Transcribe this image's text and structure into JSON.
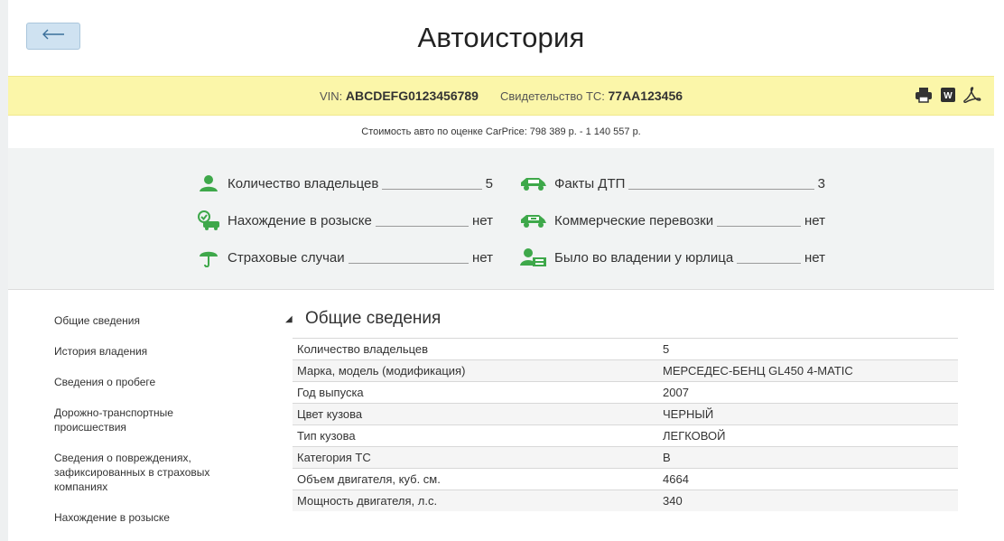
{
  "header": {
    "title": "Автоистория",
    "back_icon": "arrow-left-icon"
  },
  "vin_band": {
    "vin_label": "VIN: ",
    "vin_value": "ABCDEFG0123456789",
    "cert_label": "Свидетельство ТС: ",
    "cert_value": "77AA123456",
    "icons": [
      "printer-icon",
      "word-icon",
      "pdf-icon"
    ],
    "accent": "#fbf6a9"
  },
  "price": {
    "text": "Стоимость авто по оценке CarPrice: 798 389 р. - 1 140 557 р."
  },
  "summary": {
    "items": [
      {
        "icon": "owner-person-icon",
        "label": "Количество владельцев",
        "value": "5"
      },
      {
        "icon": "car-crash-icon",
        "label": "Факты ДТП",
        "value": "3"
      },
      {
        "icon": "car-search-icon",
        "label": "Нахождение в розыске",
        "value": "нет"
      },
      {
        "icon": "taxi-car-icon",
        "label": "Коммерческие перевозки",
        "value": "нет"
      },
      {
        "icon": "umbrella-icon",
        "label": "Страховые случаи",
        "value": "нет"
      },
      {
        "icon": "company-owner-icon",
        "label": "Было во владении у юрлица",
        "value": "нет"
      }
    ],
    "icon_color": "#3ea84a"
  },
  "sidebar": {
    "items": [
      {
        "label": "Общие сведения"
      },
      {
        "label": "История владения"
      },
      {
        "label": "Сведения о пробеге"
      },
      {
        "label": "Дорожно-транспортные происшествия"
      },
      {
        "label": "Сведения о повреждениях, зафиксированных в страховых компаниях"
      },
      {
        "label": "Нахождение в розыске"
      }
    ]
  },
  "general": {
    "title": "Общие сведения",
    "rows": [
      {
        "key": "Количество владельцев",
        "value": "5"
      },
      {
        "key": "Марка, модель (модификация)",
        "value": "МЕРСЕДЕС-БЕНЦ GL450 4-MATIC"
      },
      {
        "key": "Год выпуска",
        "value": "2007"
      },
      {
        "key": "Цвет кузова",
        "value": "ЧЕРНЫЙ"
      },
      {
        "key": "Тип кузова",
        "value": "ЛЕГКОВОЙ"
      },
      {
        "key": "Категория ТС",
        "value": "B"
      },
      {
        "key": "Объем двигателя, куб. см.",
        "value": "4664"
      },
      {
        "key": "Мощность двигателя, л.с.",
        "value": "340"
      }
    ]
  }
}
